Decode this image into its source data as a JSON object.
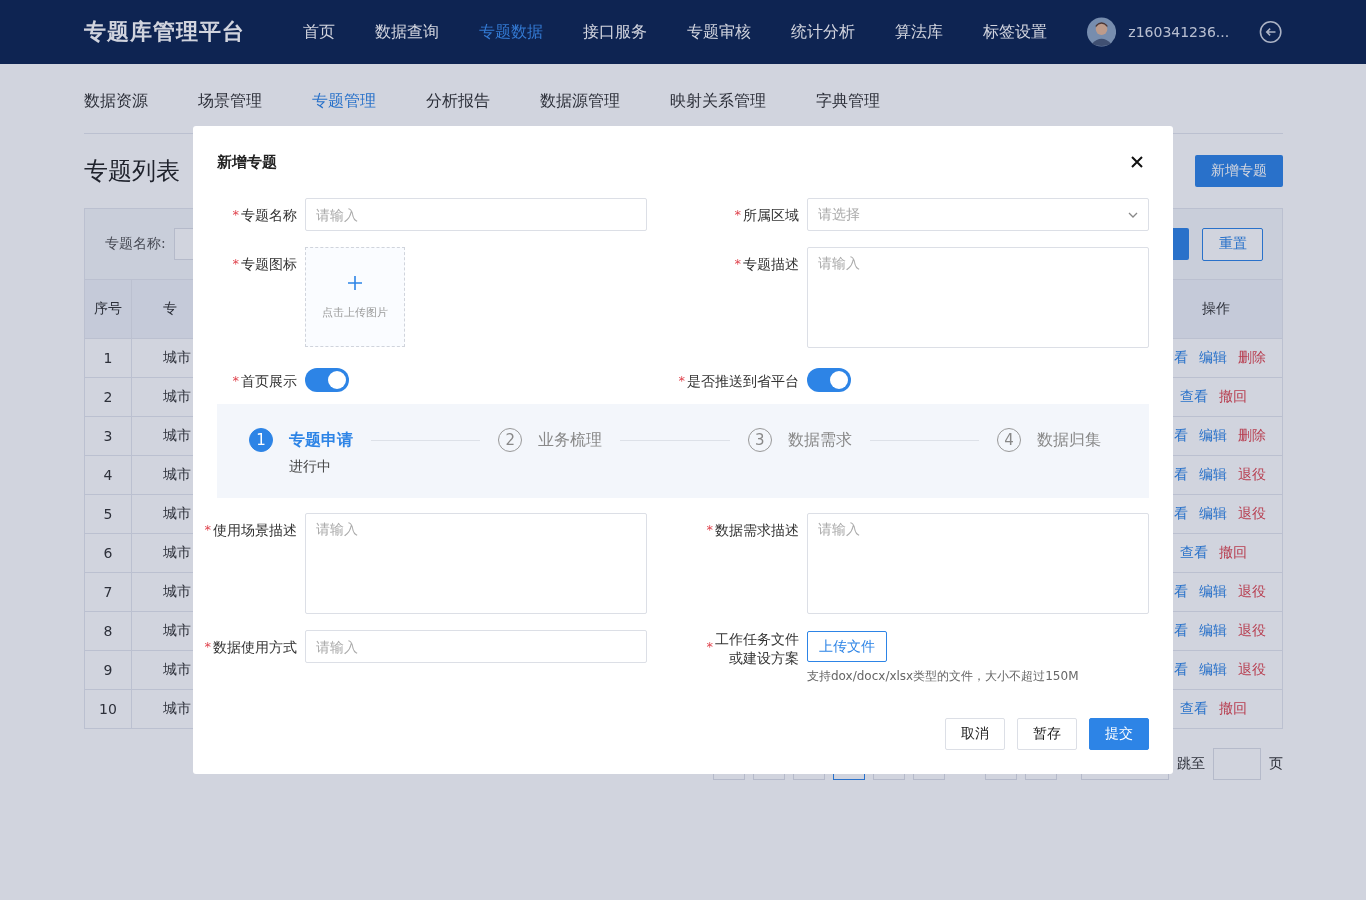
{
  "header": {
    "logo": "专题库管理平台",
    "nav": [
      {
        "label": "首页",
        "selected": false
      },
      {
        "label": "数据查询",
        "selected": false
      },
      {
        "label": "专题数据",
        "selected": true
      },
      {
        "label": "接口服务",
        "selected": false
      },
      {
        "label": "专题审核",
        "selected": false
      },
      {
        "label": "统计分析",
        "selected": false
      },
      {
        "label": "算法库",
        "selected": false
      },
      {
        "label": "标签设置",
        "selected": false
      }
    ],
    "user": {
      "name": "z160341236..."
    }
  },
  "subnav": [
    {
      "label": "数据资源",
      "selected": false
    },
    {
      "label": "场景管理",
      "selected": false
    },
    {
      "label": "专题管理",
      "selected": true
    },
    {
      "label": "分析报告",
      "selected": false
    },
    {
      "label": "数据源管理",
      "selected": false
    },
    {
      "label": "映射关系管理",
      "selected": false
    },
    {
      "label": "字典管理",
      "selected": false
    }
  ],
  "page": {
    "title": "专题列表",
    "add_button": "新增专题"
  },
  "filter": {
    "label": "专题名称:",
    "reset_button": "重置"
  },
  "table": {
    "columns": [
      "序号",
      "专",
      "操作"
    ],
    "rows": [
      {
        "index": "1",
        "column_2": "城市",
        "actions": [
          {
            "label": "看",
            "kind": "link"
          },
          {
            "label": "编辑",
            "kind": "link"
          },
          {
            "label": "删除",
            "kind": "danger"
          }
        ]
      },
      {
        "index": "2",
        "column_2": "城市",
        "actions": [
          {
            "label": "查看",
            "kind": "link"
          },
          {
            "label": "撤回",
            "kind": "danger"
          }
        ]
      },
      {
        "index": "3",
        "column_2": "城市",
        "actions": [
          {
            "label": "看",
            "kind": "link"
          },
          {
            "label": "编辑",
            "kind": "link"
          },
          {
            "label": "删除",
            "kind": "danger"
          }
        ]
      },
      {
        "index": "4",
        "column_2": "城市",
        "actions": [
          {
            "label": "看",
            "kind": "link"
          },
          {
            "label": "编辑",
            "kind": "link"
          },
          {
            "label": "退役",
            "kind": "danger"
          }
        ]
      },
      {
        "index": "5",
        "column_2": "城市",
        "actions": [
          {
            "label": "看",
            "kind": "link"
          },
          {
            "label": "编辑",
            "kind": "link"
          },
          {
            "label": "退役",
            "kind": "danger"
          }
        ]
      },
      {
        "index": "6",
        "column_2": "城市",
        "actions": [
          {
            "label": "查看",
            "kind": "link"
          },
          {
            "label": "撤回",
            "kind": "danger"
          }
        ]
      },
      {
        "index": "7",
        "column_2": "城市",
        "actions": [
          {
            "label": "看",
            "kind": "link"
          },
          {
            "label": "编辑",
            "kind": "link"
          },
          {
            "label": "退役",
            "kind": "danger"
          }
        ]
      },
      {
        "index": "8",
        "column_2": "城市",
        "actions": [
          {
            "label": "看",
            "kind": "link"
          },
          {
            "label": "编辑",
            "kind": "link"
          },
          {
            "label": "退役",
            "kind": "danger"
          }
        ]
      },
      {
        "index": "9",
        "column_2": "城市",
        "actions": [
          {
            "label": "看",
            "kind": "link"
          },
          {
            "label": "编辑",
            "kind": "link"
          },
          {
            "label": "退役",
            "kind": "danger"
          }
        ]
      },
      {
        "index": "10",
        "column_2": "城市",
        "actions": [
          {
            "label": "查看",
            "kind": "link"
          },
          {
            "label": "撤回",
            "kind": "danger"
          }
        ]
      }
    ]
  },
  "pagination": {
    "pages": [
      {
        "selected": false
      },
      {
        "selected": false
      },
      {
        "selected": false
      },
      {
        "selected": true
      },
      {
        "selected": false
      },
      {
        "selected": false
      }
    ],
    "jump_label": "跳至",
    "page_suffix": "页"
  },
  "dialog": {
    "title": "新增专题",
    "top_rows": [
      [
        {
          "kind": "input",
          "required_mark": "*",
          "label": "专题名称",
          "placeholder": "请输入"
        },
        {
          "kind": "select",
          "required_mark": "*",
          "label": "所属区域",
          "placeholder": "请选择"
        }
      ],
      [
        {
          "kind": "upload_image",
          "required_mark": "*",
          "label": "专题图标",
          "hint": "点击上传图片"
        },
        {
          "kind": "textarea",
          "required_mark": "*",
          "label": "专题描述",
          "placeholder": "请输入"
        }
      ],
      [
        {
          "kind": "switch",
          "required_mark": "*",
          "label": "首页展示",
          "on": true
        },
        {
          "kind": "switch",
          "required_mark": "*",
          "label": "是否推送到省平台",
          "on": true
        }
      ]
    ],
    "steps": [
      {
        "number": "1",
        "title": "专题申请",
        "description": "进行中",
        "selected": true
      },
      {
        "number": "2",
        "title": "业务梳理",
        "selected": false
      },
      {
        "number": "3",
        "title": "数据需求",
        "selected": false
      },
      {
        "number": "4",
        "title": "数据归集",
        "selected": false
      }
    ],
    "bottom_rows": [
      [
        {
          "kind": "textarea",
          "required_mark": "*",
          "label": "使用场景描述",
          "placeholder": "请输入"
        },
        {
          "kind": "textarea",
          "required_mark": "*",
          "label": "数据需求描述",
          "placeholder": "请输入"
        }
      ],
      [
        {
          "kind": "input",
          "required_mark": "*",
          "label": "数据使用方式",
          "placeholder": "请输入"
        },
        {
          "kind": "upload_file",
          "required_mark": "*",
          "label_lines": [
            "工作任务文件",
            "或建设方案"
          ],
          "button": "上传文件",
          "hint": "支持dox/docx/xlsx类型的文件，大小不超过150M"
        }
      ]
    ],
    "buttons": [
      {
        "label": "取消",
        "kind": "default"
      },
      {
        "label": "暂存",
        "kind": "default"
      },
      {
        "label": "提交",
        "kind": "primary"
      }
    ]
  }
}
